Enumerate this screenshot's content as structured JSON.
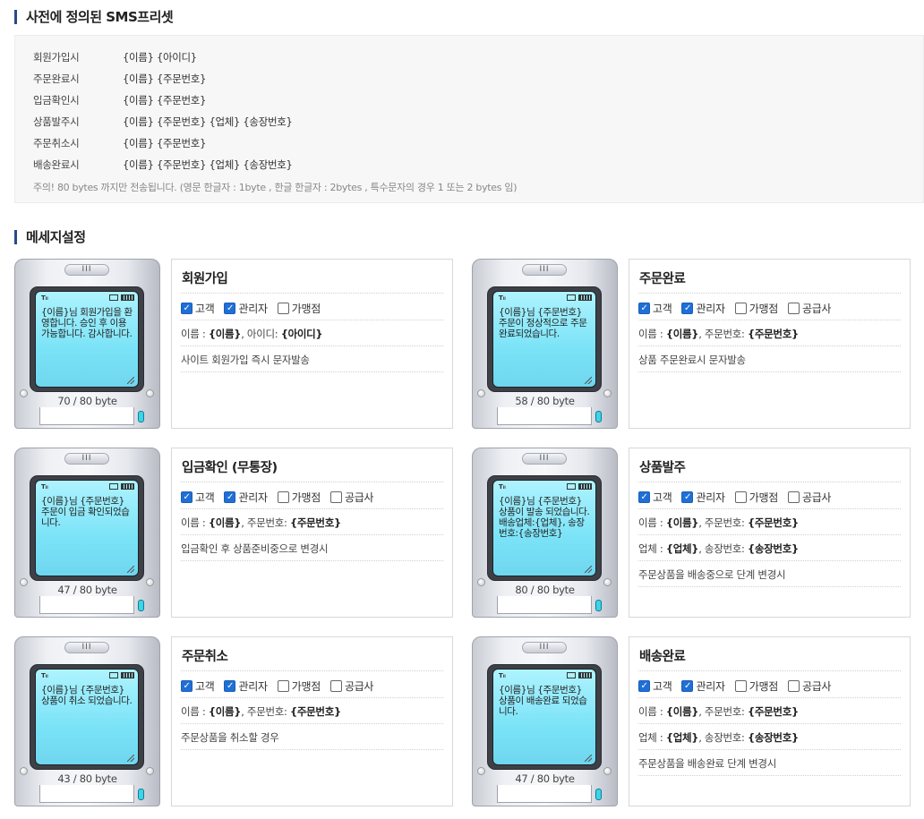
{
  "preset": {
    "title": "사전에 정의된 SMS프리셋",
    "rows": [
      {
        "label": "회원가입시",
        "value": "{이름} {아이디}"
      },
      {
        "label": "주문완료시",
        "value": "{이름} {주문번호}"
      },
      {
        "label": "입금확인시",
        "value": "{이름} {주문번호}"
      },
      {
        "label": "상품발주시",
        "value": "{이름} {주문번호} {업체} {송장번호}"
      },
      {
        "label": "주문취소시",
        "value": "{이름} {주문번호}"
      },
      {
        "label": "배송완료시",
        "value": "{이름} {주문번호} {업체} {송장번호}"
      }
    ],
    "note": "주의! 80 bytes 까지만 전송됩니다. (영문 한글자 : 1byte , 한글 한글자 : 2bytes , 특수문자의 경우 1 또는 2 bytes 임)"
  },
  "settings": {
    "title": "메세지설정",
    "phone_label": "III",
    "cards": [
      {
        "title": "회원가입",
        "message": "{이름}님 회원가입을 환영합니다. 승인 후 이용가능합니다. 감사합니다.",
        "count": "70 / 80 byte",
        "options": [
          {
            "label": "고객",
            "checked": true
          },
          {
            "label": "관리자",
            "checked": true
          },
          {
            "label": "가맹점",
            "checked": false
          }
        ],
        "info": [
          [
            {
              "t": "이름 : ",
              "b": false
            },
            {
              "t": "{이름}",
              "b": true
            },
            {
              "t": ", 아이디: ",
              "b": false
            },
            {
              "t": "{아이디}",
              "b": true
            }
          ],
          [
            {
              "t": "사이트 회원가입 즉시 문자발송",
              "b": false
            }
          ]
        ]
      },
      {
        "title": "주문완료",
        "message": "{이름}님 {주문번호} 주문이 정상적으로 주문완료되었습니다.",
        "count": "58 / 80 byte",
        "options": [
          {
            "label": "고객",
            "checked": true
          },
          {
            "label": "관리자",
            "checked": true
          },
          {
            "label": "가맹점",
            "checked": false
          },
          {
            "label": "공급사",
            "checked": false
          }
        ],
        "info": [
          [
            {
              "t": "이름 : ",
              "b": false
            },
            {
              "t": "{이름}",
              "b": true
            },
            {
              "t": ", 주문번호: ",
              "b": false
            },
            {
              "t": "{주문번호}",
              "b": true
            }
          ],
          [
            {
              "t": "상품 주문완료시 문자발송",
              "b": false
            }
          ]
        ]
      },
      {
        "title": "입금확인 (무통장)",
        "message": "{이름}님 {주문번호} 주문이 입금 확인되었습니다.",
        "count": "47 / 80 byte",
        "options": [
          {
            "label": "고객",
            "checked": true
          },
          {
            "label": "관리자",
            "checked": true
          },
          {
            "label": "가맹점",
            "checked": false
          },
          {
            "label": "공급사",
            "checked": false
          }
        ],
        "info": [
          [
            {
              "t": "이름 : ",
              "b": false
            },
            {
              "t": "{이름}",
              "b": true
            },
            {
              "t": ", 주문번호: ",
              "b": false
            },
            {
              "t": "{주문번호}",
              "b": true
            }
          ],
          [
            {
              "t": "입금확인 후 상품준비중으로 변경시",
              "b": false
            }
          ]
        ]
      },
      {
        "title": "상품발주",
        "message": "{이름}님 {주문번호} 상품이 발송 되었습니다. 배송업체:{업체}, 송장번호:{송장번호}",
        "count": "80 / 80 byte",
        "options": [
          {
            "label": "고객",
            "checked": true
          },
          {
            "label": "관리자",
            "checked": true
          },
          {
            "label": "가맹점",
            "checked": false
          },
          {
            "label": "공급사",
            "checked": false
          }
        ],
        "info": [
          [
            {
              "t": "이름 : ",
              "b": false
            },
            {
              "t": "{이름}",
              "b": true
            },
            {
              "t": ", 주문번호: ",
              "b": false
            },
            {
              "t": "{주문번호}",
              "b": true
            }
          ],
          [
            {
              "t": "업체 : ",
              "b": false
            },
            {
              "t": "{업체}",
              "b": true
            },
            {
              "t": ", 송장번호: ",
              "b": false
            },
            {
              "t": "{송장번호}",
              "b": true
            }
          ],
          [
            {
              "t": "주문상품을 배송중으로 단계 변경시",
              "b": false
            }
          ]
        ]
      },
      {
        "title": "주문취소",
        "message": "{이름}님 {주문번호} 상품이 취소 되었습니다.",
        "count": "43 / 80 byte",
        "options": [
          {
            "label": "고객",
            "checked": true
          },
          {
            "label": "관리자",
            "checked": true
          },
          {
            "label": "가맹점",
            "checked": false
          },
          {
            "label": "공급사",
            "checked": false
          }
        ],
        "info": [
          [
            {
              "t": "이름 : ",
              "b": false
            },
            {
              "t": "{이름}",
              "b": true
            },
            {
              "t": ", 주문번호: ",
              "b": false
            },
            {
              "t": "{주문번호}",
              "b": true
            }
          ],
          [
            {
              "t": "주문상품을 취소할 경우",
              "b": false
            }
          ]
        ]
      },
      {
        "title": "배송완료",
        "message": "{이름}님 {주문번호} 상품이 배송완료 되었습니다.",
        "count": "47 / 80 byte",
        "options": [
          {
            "label": "고객",
            "checked": true
          },
          {
            "label": "관리자",
            "checked": true
          },
          {
            "label": "가맹점",
            "checked": false
          },
          {
            "label": "공급사",
            "checked": false
          }
        ],
        "info": [
          [
            {
              "t": "이름 : ",
              "b": false
            },
            {
              "t": "{이름}",
              "b": true
            },
            {
              "t": ", 주문번호: ",
              "b": false
            },
            {
              "t": "{주문번호}",
              "b": true
            }
          ],
          [
            {
              "t": "업체 : ",
              "b": false
            },
            {
              "t": "{업체}",
              "b": true
            },
            {
              "t": ", 송장번호: ",
              "b": false
            },
            {
              "t": "{송장번호}",
              "b": true
            }
          ],
          [
            {
              "t": "주문상품을 배송완료 단계 변경시",
              "b": false
            }
          ]
        ]
      }
    ]
  }
}
